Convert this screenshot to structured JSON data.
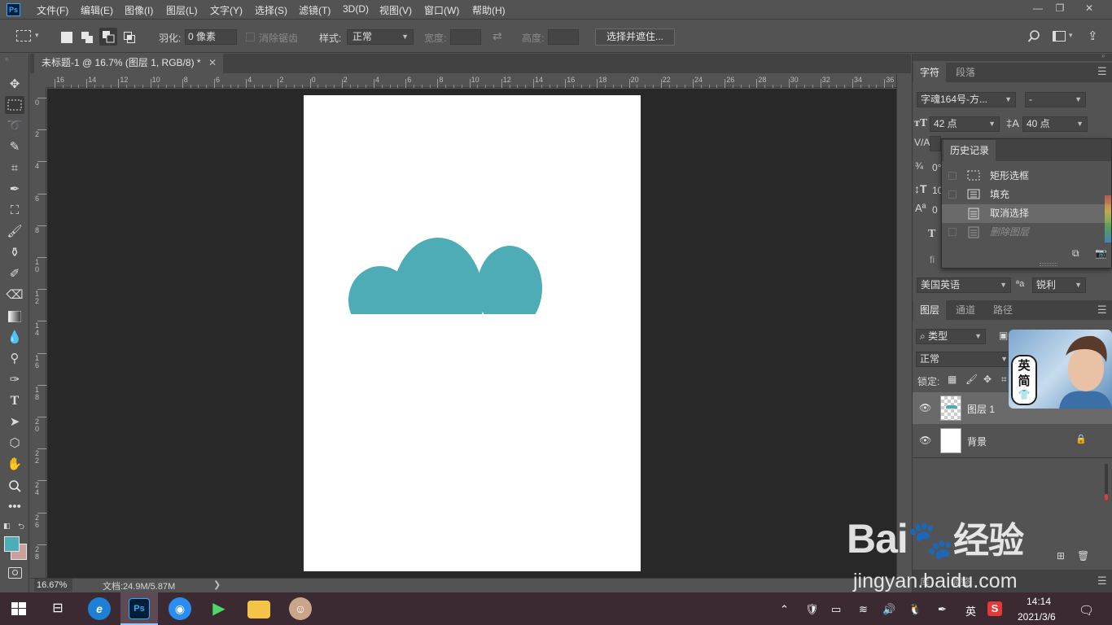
{
  "menu": {
    "logo": "Ps",
    "items": [
      "文件(F)",
      "编辑(E)",
      "图像(I)",
      "图层(L)",
      "文字(Y)",
      "选择(S)",
      "滤镜(T)",
      "3D(D)",
      "视图(V)",
      "窗口(W)",
      "帮助(H)"
    ]
  },
  "window_controls": {
    "minimize": "—",
    "restore": "❐",
    "close": "✕"
  },
  "options": {
    "feather_label": "羽化:",
    "feather_value": "0 像素",
    "antialias_label": "消除锯齿",
    "style_label": "样式:",
    "style_value": "正常",
    "width_label": "宽度:",
    "height_label": "高度:",
    "select_mask_button": "选择并遮住..."
  },
  "document": {
    "tab_title": "未标题-1 @ 16.7% (图层 1, RGB/8) *",
    "close": "✕",
    "zoom": "16.67%",
    "doc_info": "文档:24.9M/5.87M",
    "status_caret": "❯",
    "shape_color": "#4dacb5",
    "canvas_color": "#ffffff"
  },
  "rulers": {
    "horizontal": [
      "16",
      "14",
      "12",
      "10",
      "8",
      "6",
      "4",
      "2",
      "0",
      "2",
      "4",
      "6",
      "8",
      "10",
      "12",
      "14",
      "16",
      "18",
      "20",
      "22",
      "24",
      "26",
      "28",
      "30",
      "32",
      "34",
      "36"
    ],
    "vertical": [
      "0",
      "2",
      "4",
      "6",
      "8",
      "10",
      "12",
      "14",
      "16",
      "18",
      "20",
      "22",
      "24",
      "26",
      "28"
    ]
  },
  "tools": [
    "move",
    "marquee",
    "lasso",
    "quick-select",
    "crop",
    "eyedropper",
    "healing",
    "brush",
    "stamp",
    "history-brush",
    "eraser",
    "gradient",
    "blur",
    "dodge",
    "pen",
    "type",
    "path-select",
    "shape",
    "hand",
    "zoom",
    "more"
  ],
  "colors": {
    "foreground": "#4dacb5",
    "background": "#c9a09a"
  },
  "character_panel": {
    "tabs": [
      "字符",
      "段落"
    ],
    "font_family": "字魂164号-方...",
    "font_style": "-",
    "font_size": "42 点",
    "leading": "40 点",
    "kerning_label": "V/A",
    "tracking_value": "0°",
    "vscale_value": "10",
    "baseline_value": "0",
    "language": "美国英语",
    "aa_label": "ªa",
    "antialias": "锐利",
    "type_glyph": "T",
    "fi_glyph": "fi"
  },
  "history_panel": {
    "title": "历史记录",
    "items": [
      {
        "label": "矩形选框",
        "icon": "marquee-icon"
      },
      {
        "label": "填充",
        "icon": "fill-icon"
      },
      {
        "label": "取消选择",
        "icon": "document-icon"
      },
      {
        "label": "删除图层",
        "icon": "document-icon"
      }
    ]
  },
  "layers_panel": {
    "tabs": [
      "图层",
      "通道",
      "路径"
    ],
    "filter_kind": "类型",
    "blend_mode": "正常",
    "lock_label": "锁定:",
    "layers": [
      {
        "name": "图层 1",
        "visible_icon": "👁"
      },
      {
        "name": "背景",
        "visible_icon": "👁"
      }
    ],
    "bottom_tabs": [
      "库",
      "调整"
    ]
  },
  "ime_sticker": {
    "line1": "英",
    "line2": "简"
  },
  "watermark": {
    "brand": "Bai",
    "brand_cn": "经验",
    "url": "jingyan.baidu.com"
  },
  "taskbar": {
    "apps": [
      "start",
      "task-view",
      "ie",
      "photoshop",
      "browser",
      "media",
      "explorer",
      "avatar"
    ],
    "ps_label": "Ps",
    "ime_lang": "英",
    "time": "14:14",
    "date": "2021/3/6"
  }
}
